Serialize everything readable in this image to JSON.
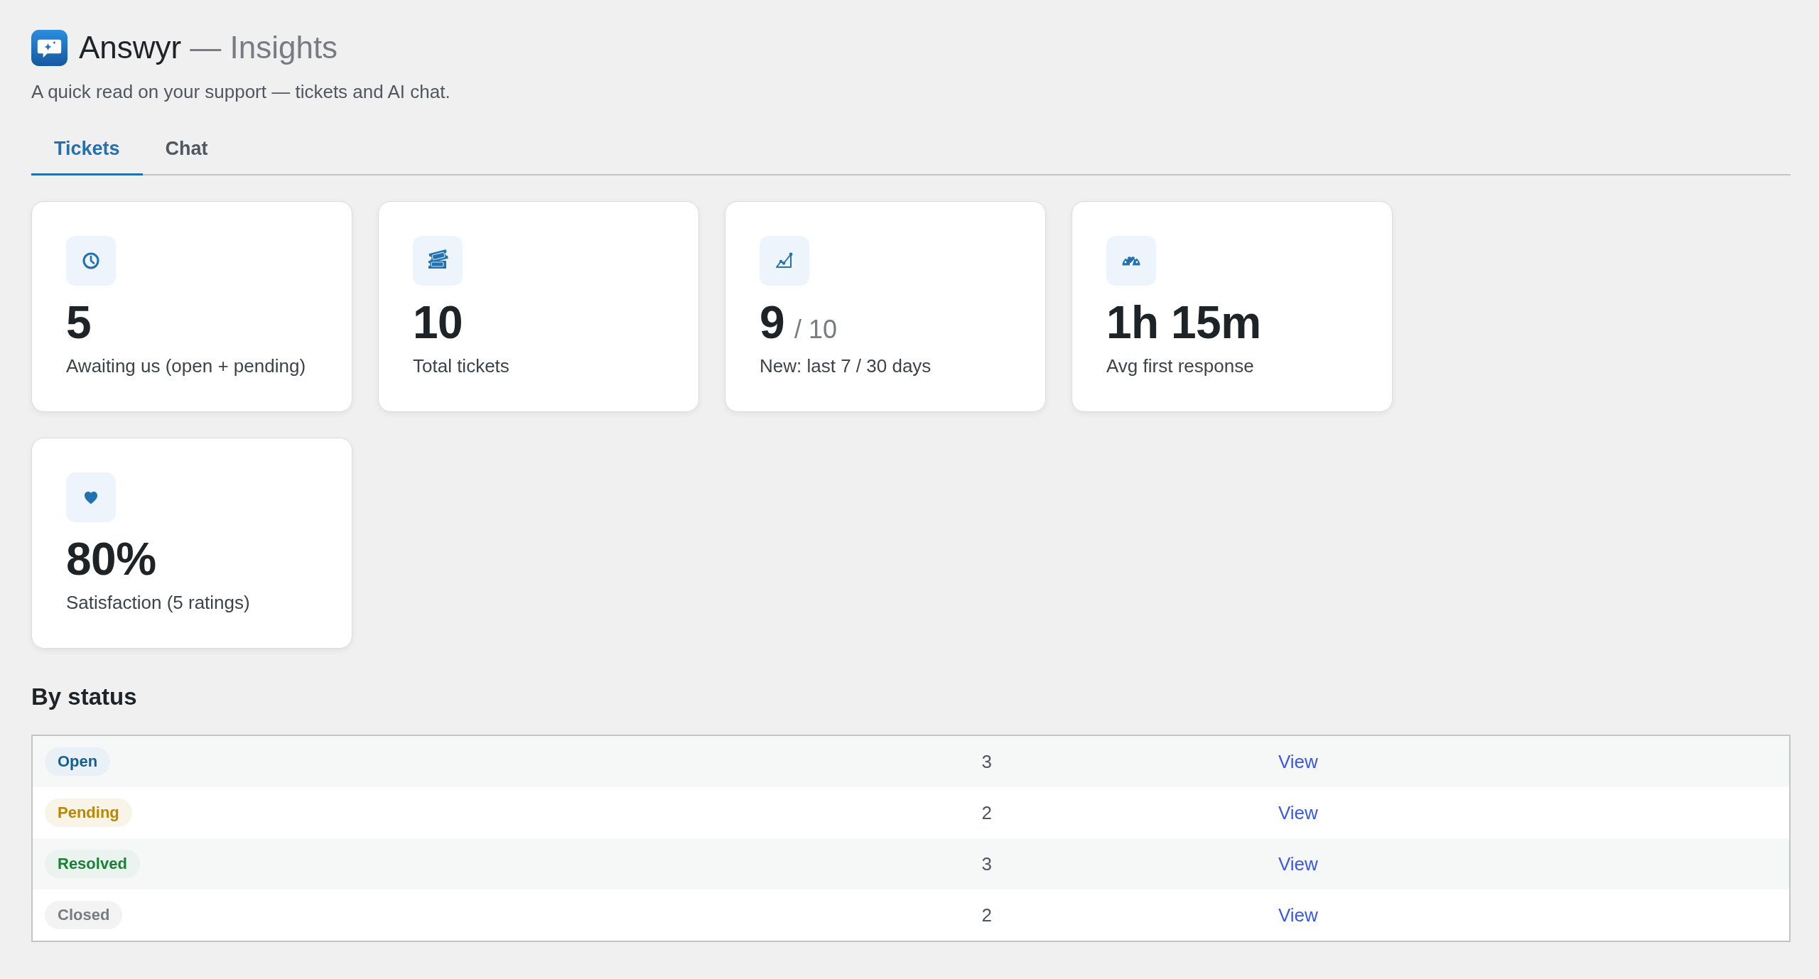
{
  "header": {
    "app_name": "Answyr",
    "section": "— Insights",
    "subtitle": "A quick read on your support — tickets and AI chat."
  },
  "tabs": [
    {
      "label": "Tickets",
      "selected": true
    },
    {
      "label": "Chat",
      "selected": false
    }
  ],
  "stats": [
    {
      "value": "5",
      "label": "Awaiting us (open + pending)"
    },
    {
      "value": "10",
      "label": "Total tickets"
    },
    {
      "value": "9",
      "total": "/ 10",
      "label": "New: last 7 / 30 days"
    },
    {
      "value": "1h 15m",
      "label": "Avg first response"
    },
    {
      "value": "80%",
      "label": "Satisfaction (5 ratings)"
    }
  ],
  "by_status": {
    "heading": "By status",
    "rows": [
      {
        "status": "Open",
        "color": "#135e96",
        "count": "3",
        "link": "View"
      },
      {
        "status": "Pending",
        "color": "#bd8600",
        "count": "2",
        "link": "View"
      },
      {
        "status": "Resolved",
        "color": "#1a7f37",
        "count": "3",
        "link": "View"
      },
      {
        "status": "Closed",
        "color": "#787c82",
        "count": "2",
        "link": "View"
      }
    ]
  }
}
